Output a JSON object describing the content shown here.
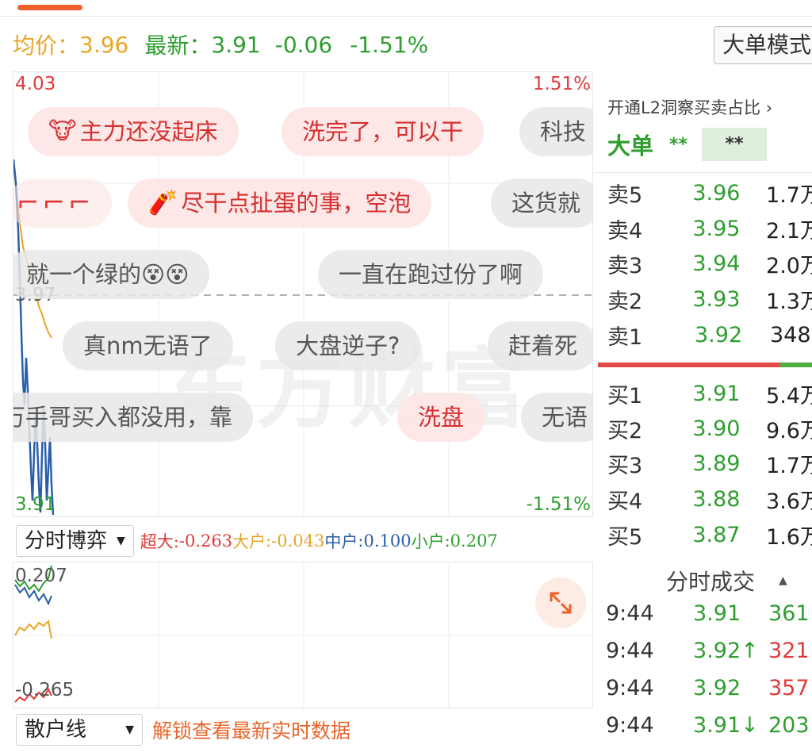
{
  "header": {
    "avg_label": "均价：",
    "avg_value": "3.96",
    "latest_label": "最新：",
    "latest_value": "3.91",
    "change": "-0.06",
    "change_pct": "-1.51%",
    "mode_button": "大单模式"
  },
  "main_chart": {
    "y_max": "4.03",
    "y_mid": "3.97",
    "y_min": "3.91",
    "pct_max": "1.51%",
    "pct_min": "-1.51%",
    "watermark": "东方财富"
  },
  "danmu": [
    {
      "text": "主力还没起床",
      "emo": "🐮"
    },
    {
      "text": "洗完了，可以干"
    },
    {
      "text": "科技"
    },
    {
      "text": "尽干点扯蛋的事，空泡",
      "emo": "🧨"
    },
    {
      "text": "这货就"
    },
    {
      "text": "就一个绿的😵😵"
    },
    {
      "text": "一直在跑过份了啊"
    },
    {
      "text": "真nm无语了"
    },
    {
      "text": "大盘逆子?"
    },
    {
      "text": "赶着死"
    },
    {
      "text": "万手哥买入都没用，靠"
    },
    {
      "text": "洗盘"
    },
    {
      "text": "无语"
    }
  ],
  "indicator": {
    "select_label": "分时博弈",
    "super_label": "超大:",
    "super_value": "-0.263",
    "large_label": "大户",
    "large_value": ":-0.043",
    "mid_label": "中户",
    "mid_value": ":0.100",
    "small_label": "小户",
    "small_value": ":0.207"
  },
  "sub_chart": {
    "y_max": "0.207",
    "y_min": "-0.265"
  },
  "bottom": {
    "select_label": "散户线",
    "unlock_text": "解锁查看最新实时数据"
  },
  "right_panel": {
    "l2_link": "开通L2洞察买卖占比",
    "big_order_label": "大单",
    "big_order_buy": "**",
    "big_order_sell": "**",
    "asks": [
      {
        "label": "卖5",
        "price": "3.96",
        "vol": "1.7万"
      },
      {
        "label": "卖4",
        "price": "3.95",
        "vol": "2.1万"
      },
      {
        "label": "卖3",
        "price": "3.94",
        "vol": "2.0万"
      },
      {
        "label": "卖2",
        "price": "3.93",
        "vol": "1.3万"
      },
      {
        "label": "卖1",
        "price": "3.92",
        "vol": "348"
      }
    ],
    "bids": [
      {
        "label": "买1",
        "price": "3.91",
        "vol": "5.4万"
      },
      {
        "label": "买2",
        "price": "3.90",
        "vol": "9.6万"
      },
      {
        "label": "买3",
        "price": "3.89",
        "vol": "1.7万"
      },
      {
        "label": "买4",
        "price": "3.88",
        "vol": "3.6万"
      },
      {
        "label": "买5",
        "price": "3.87",
        "vol": "1.6万"
      }
    ],
    "trades_header": "分时成交",
    "trades": [
      {
        "time": "9:44",
        "price": "3.91",
        "vol": "361",
        "vol_color": "#2f9e2f"
      },
      {
        "time": "9:44",
        "price": "3.92↑",
        "vol": "321",
        "vol_color": "#e03a3a"
      },
      {
        "time": "9:44",
        "price": "3.92",
        "vol": "357",
        "vol_color": "#e03a3a"
      },
      {
        "time": "9:44",
        "price": "3.91↓",
        "vol": "203",
        "vol_color": "#2f9e2f"
      }
    ]
  },
  "colors": {
    "up": "#e03a3a",
    "down": "#2f9e2f",
    "avg": "#e8a526",
    "price_line": "#2b5fa8",
    "accent": "#f0602a"
  }
}
